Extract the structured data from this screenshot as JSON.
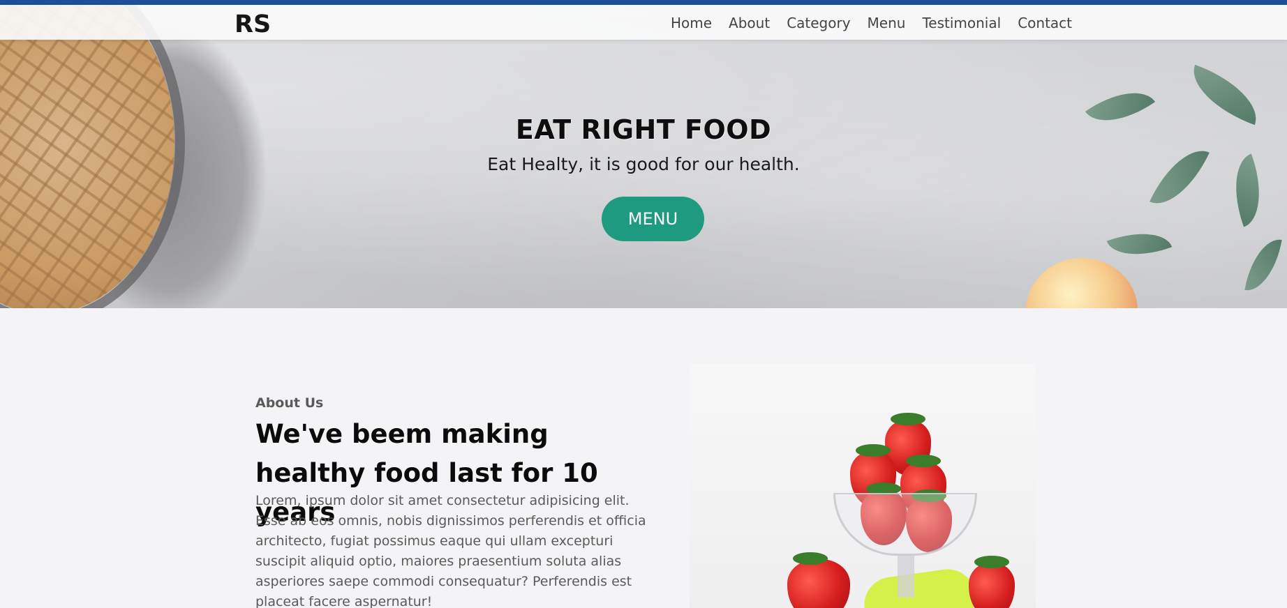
{
  "nav": {
    "logo": "RS",
    "links": [
      "Home",
      "About",
      "Category",
      "Menu",
      "Testimonial",
      "Contact"
    ]
  },
  "hero": {
    "title": "EAT RIGHT FOOD",
    "subtitle": "Eat Healty, it is good for our health.",
    "button_label": "MENU"
  },
  "about": {
    "kicker": "About Us",
    "heading": "We've beem making healthy food last for 10 years",
    "body": "Lorem, ipsum dolor sit amet consectetur adipisicing elit. Esse ab eos omnis, nobis dignissimos perferendis et officia architecto, fugiat possimus eaque qui ullam excepturi suscipit aliquid optio, maiores praesentium soluta alias asperiores saepe commodi consequatur? Perferendis est placeat facere aspernatur!"
  },
  "colors": {
    "accent_bar": "#1b4f9a",
    "button": "#1e9a7e"
  }
}
